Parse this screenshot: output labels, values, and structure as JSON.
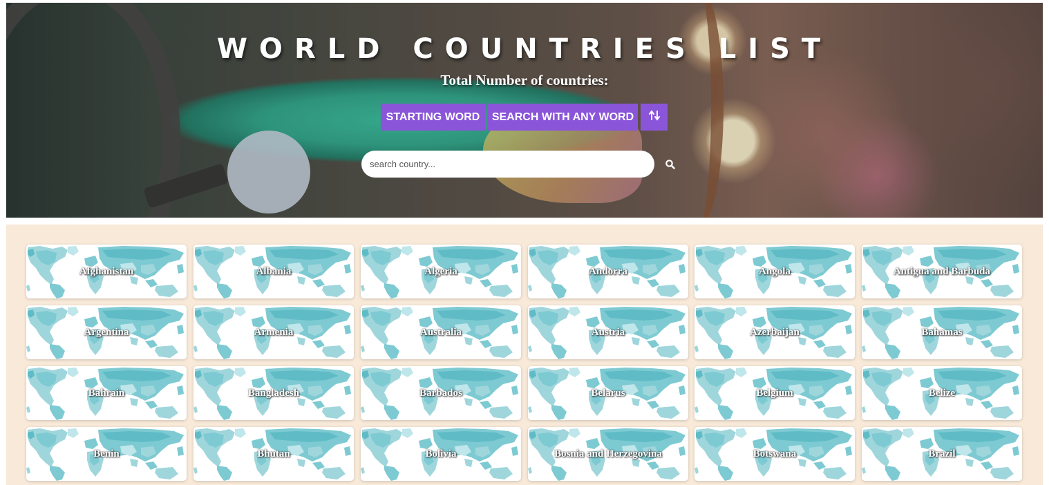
{
  "header": {
    "title": "WORLD COUNTRIES LIST",
    "subtitle": "Total Number of countries:"
  },
  "buttons": {
    "starting_word": "STARTING WORD",
    "search_any_word": "SEARCH WITH ANY WORD",
    "sort_icon": "sort-arrows-icon"
  },
  "search": {
    "placeholder": "search country...",
    "value": "",
    "icon": "search-icon"
  },
  "colors": {
    "accent": "#8a55d9",
    "grid_background": "#f8e9d8",
    "map_teal": "#7ecad2",
    "map_light": "#bfe6ea"
  },
  "countries": [
    "Afghanistan",
    "Albania",
    "Algeria",
    "Andorra",
    "Angola",
    "Antigua and Barbuda",
    "Argentina",
    "Armenia",
    "Australia",
    "Austria",
    "Azerbaijan",
    "Bahamas",
    "Bahrain",
    "Bangladesh",
    "Barbados",
    "Belarus",
    "Belgium",
    "Belize",
    "Benin",
    "Bhutan",
    "Bolivia",
    "Bosnia and Herzegovina",
    "Botswana",
    "Brazil"
  ]
}
